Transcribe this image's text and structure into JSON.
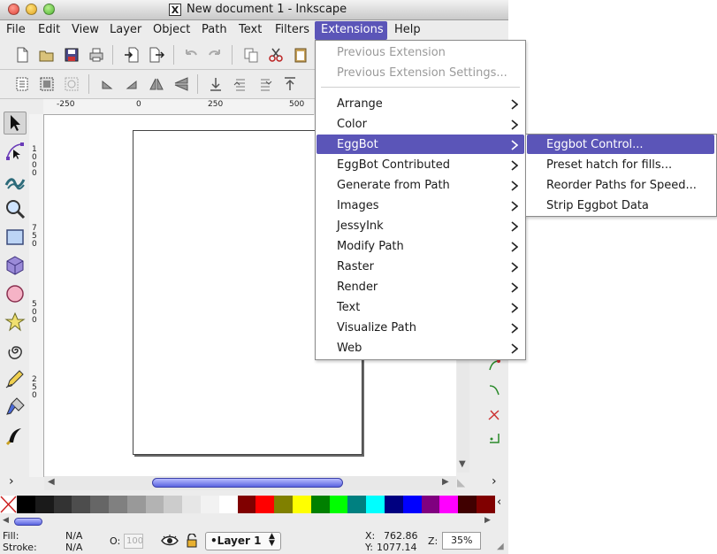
{
  "window": {
    "title": "New document 1 - Inkscape",
    "app_icon": "X"
  },
  "menubar": {
    "file": "File",
    "edit": "Edit",
    "view": "View",
    "layer": "Layer",
    "object": "Object",
    "path": "Path",
    "text": "Text",
    "filters": "Filters",
    "extensions": "Extensions",
    "help": "Help"
  },
  "ruler": {
    "h_labels": [
      "-250",
      "0",
      "250",
      "500"
    ],
    "v_labels": [
      "1000",
      "750",
      "500",
      "250"
    ]
  },
  "extensions_menu": {
    "previous_extension": "Previous Extension",
    "previous_extension_settings": "Previous Extension Settings...",
    "items": [
      "Arrange",
      "Color",
      "EggBot",
      "EggBot Contributed",
      "Generate from Path",
      "Images",
      "JessyInk",
      "Modify Path",
      "Raster",
      "Render",
      "Text",
      "Visualize Path",
      "Web"
    ],
    "selected": "EggBot"
  },
  "eggbot_submenu": {
    "items": [
      "Eggbot Control...",
      "Preset hatch for fills...",
      "Reorder Paths for Speed...",
      "Strip Eggbot Data"
    ],
    "selected": "Eggbot Control..."
  },
  "status": {
    "fill_label": "Fill:",
    "fill_value": "N/A",
    "stroke_label": "Stroke:",
    "stroke_value": "N/A",
    "opacity_label": "O:",
    "opacity_value": "100",
    "layer": "•Layer 1",
    "x_label": "X:",
    "x_value": "762.86",
    "y_label": "Y:",
    "y_value": "1077.14",
    "zoom_label": "Z:",
    "zoom_value": "35%"
  },
  "palette": [
    "#000000",
    "#1a1a1a",
    "#333333",
    "#4d4d4d",
    "#666666",
    "#808080",
    "#999999",
    "#b3b3b3",
    "#cccccc",
    "#e6e6e6",
    "#f2f2f2",
    "#ffffff",
    "#800000",
    "#ff0000",
    "#808000",
    "#ffff00",
    "#008000",
    "#00ff00",
    "#008080",
    "#00ffff",
    "#000080",
    "#0000ff",
    "#800080",
    "#ff00ff",
    "#400000",
    "#800000"
  ],
  "colors": {
    "accent": "#5b55b8"
  }
}
